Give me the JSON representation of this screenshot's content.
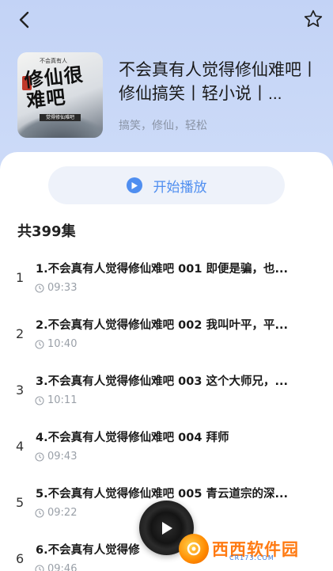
{
  "book": {
    "title": "不会真有人觉得修仙难吧丨修仙搞笑丨轻小说丨...",
    "tags": "搞笑，修仙，轻松",
    "cover_text": "修仙很难吧",
    "cover_top_text": "不会真有人",
    "cover_band_text": "觉得修仙难吧"
  },
  "play_all": {
    "label": "开始播放"
  },
  "episode_count": "共399集",
  "episodes": [
    {
      "index": "1",
      "title": "1.不会真有人觉得修仙难吧 001 即便是骗，也...",
      "duration": "09:33"
    },
    {
      "index": "2",
      "title": "2.不会真有人觉得修仙难吧 002 我叫叶平，平...",
      "duration": "10:40"
    },
    {
      "index": "3",
      "title": "3.不会真有人觉得修仙难吧 003 这个大师兄，...",
      "duration": "10:11"
    },
    {
      "index": "4",
      "title": "4.不会真有人觉得修仙难吧 004 拜师",
      "duration": "09:43"
    },
    {
      "index": "5",
      "title": "5.不会真有人觉得修仙难吧 005 青云道宗的深...",
      "duration": "09:22"
    },
    {
      "index": "6",
      "title": "6.不会真有人觉得修",
      "duration": "09:46"
    }
  ],
  "watermark": {
    "text": "西西软件园",
    "sub": "CR173.COM"
  },
  "colors": {
    "accent": "#4f8ef0",
    "header_bg": "#c9d8f7"
  }
}
